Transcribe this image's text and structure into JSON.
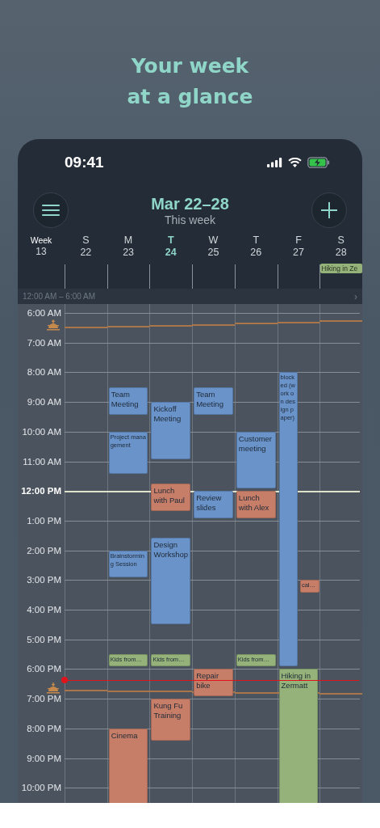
{
  "headline": [
    "Your week",
    "at a glance"
  ],
  "status_bar": {
    "time": "09:41"
  },
  "header": {
    "title": "Mar 22–28",
    "subtitle": "This week"
  },
  "week": {
    "label": "Week",
    "number": "13"
  },
  "collapsed_range": {
    "label": "12:00 AM – 6:00 AM",
    "chevron": "›"
  },
  "hours": [
    {
      "label": "6:00 AM",
      "bold": false
    },
    {
      "label": "7:00 AM",
      "bold": false
    },
    {
      "label": "8:00 AM",
      "bold": false
    },
    {
      "label": "9:00 AM",
      "bold": false
    },
    {
      "label": "10:00 AM",
      "bold": false
    },
    {
      "label": "11:00 AM",
      "bold": false
    },
    {
      "label": "12:00 PM",
      "bold": true
    },
    {
      "label": "1:00 PM",
      "bold": false
    },
    {
      "label": "2:00 PM",
      "bold": false
    },
    {
      "label": "3:00 PM",
      "bold": false
    },
    {
      "label": "4:00 PM",
      "bold": false
    },
    {
      "label": "5:00 PM",
      "bold": false
    },
    {
      "label": "6:00 PM",
      "bold": false
    },
    {
      "label": "7:00 PM",
      "bold": false
    },
    {
      "label": "8:00 PM",
      "bold": false
    },
    {
      "label": "9:00 PM",
      "bold": false
    },
    {
      "label": "10:00 PM",
      "bold": false
    }
  ],
  "days": [
    {
      "letter": "S",
      "date": "22",
      "selected": false
    },
    {
      "letter": "M",
      "date": "23",
      "selected": false,
      "events": [
        {
          "title": "Team Meeting",
          "kind": "regular",
          "color": "#6a93c9"
        },
        {
          "title": "Project management",
          "kind": "compact",
          "color": "#6a93c9"
        },
        {
          "title": "Brainstorming Session",
          "kind": "compact",
          "color": "#6a93c9"
        },
        {
          "title": "Kids from…",
          "kind": "compact",
          "color": "#94b279"
        },
        {
          "title": "Cinema",
          "kind": "regular",
          "color": "#c67e69"
        }
      ]
    },
    {
      "letter": "T",
      "date": "24",
      "selected": true,
      "events": [
        {
          "title": "Kickoff Meeting",
          "kind": "regular",
          "color": "#6a93c9"
        },
        {
          "title": "Lunch with Paul",
          "kind": "regular",
          "color": "#c67e69"
        },
        {
          "title": "Design Workshop",
          "kind": "regular",
          "color": "#6a93c9"
        },
        {
          "title": "Kids from…",
          "kind": "compact",
          "color": "#94b279"
        },
        {
          "title": "Kung Fu Training",
          "kind": "regular",
          "color": "#c67e69"
        }
      ]
    },
    {
      "letter": "W",
      "date": "25",
      "selected": false,
      "events": [
        {
          "title": "Team Meeting",
          "kind": "regular",
          "color": "#6a93c9"
        },
        {
          "title": "Review slides",
          "kind": "regular",
          "color": "#6a93c9"
        },
        {
          "title": "Repair bike",
          "kind": "regular",
          "color": "#c67e69"
        }
      ]
    },
    {
      "letter": "T",
      "date": "26",
      "selected": false,
      "events": [
        {
          "title": "Customer meeting",
          "kind": "regular",
          "color": "#6a93c9"
        },
        {
          "title": "Lunch with Alex",
          "kind": "regular",
          "color": "#c67e69"
        },
        {
          "title": "Kids from…",
          "kind": "compact",
          "color": "#94b279"
        }
      ]
    },
    {
      "letter": "F",
      "date": "27",
      "selected": false,
      "events": [
        {
          "title": "blocked (work on design paper)",
          "kind": "compact",
          "color": "#6a93c9"
        },
        {
          "title": "cal…",
          "kind": "compact",
          "color": "#c67e69"
        },
        {
          "title": "Hiking in Zermatt",
          "kind": "regular",
          "color": "#94b279"
        }
      ]
    },
    {
      "letter": "S",
      "date": "28",
      "selected": false,
      "all_day": [
        {
          "title": "Hiking in Ze",
          "color": "#94b279"
        }
      ]
    }
  ]
}
